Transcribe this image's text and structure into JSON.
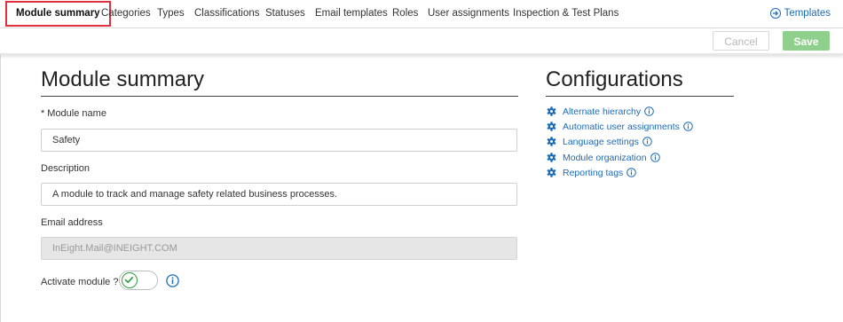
{
  "nav": {
    "tabs": [
      {
        "label": "Module summary"
      },
      {
        "label": "Categories"
      },
      {
        "label": "Types"
      },
      {
        "label": "Classifications"
      },
      {
        "label": "Statuses"
      },
      {
        "label": "Email templates"
      },
      {
        "label": "Roles"
      },
      {
        "label": "User assignments"
      },
      {
        "label": "Inspection & Test Plans"
      }
    ],
    "active_tab": "Module summary",
    "templates_link": "Templates"
  },
  "actions": {
    "cancel_label": "Cancel",
    "save_label": "Save"
  },
  "summary": {
    "title": "Module summary",
    "module_name_label": "Module name",
    "module_name_required_mark": "*",
    "module_name_value": "Safety",
    "description_label": "Description",
    "description_value": "A module to track and manage safety related business processes.",
    "email_label": "Email address",
    "email_value": "InEight.Mail@INEIGHT.COM",
    "activate_label": "Activate module ?",
    "activate_on": true
  },
  "configurations": {
    "title": "Configurations",
    "items": [
      {
        "label": "Alternate hierarchy",
        "icon": "gear-icon"
      },
      {
        "label": "Automatic user assignments",
        "icon": "gear-icon"
      },
      {
        "label": "Language settings",
        "icon": "gear-icon"
      },
      {
        "label": "Module organization",
        "icon": "gear-icon"
      },
      {
        "label": "Reporting tags",
        "icon": "gear-icon"
      }
    ]
  },
  "colors": {
    "link_blue": "#1c6bb8",
    "active_tab_border": "#e0303d",
    "save_green": "#8fd08c",
    "toggle_green": "#2e9e3f"
  }
}
